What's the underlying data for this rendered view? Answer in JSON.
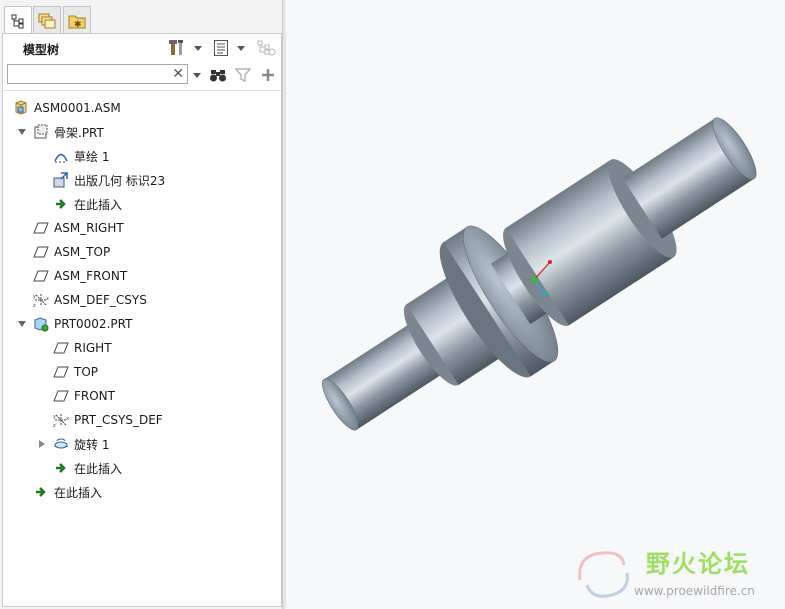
{
  "tabs": [
    {
      "name": "model-tree-tab",
      "icon": "model-tree-icon"
    },
    {
      "name": "layers-tab",
      "icon": "layers-icon"
    },
    {
      "name": "favorites-tab",
      "icon": "folder-star-icon"
    }
  ],
  "panel": {
    "title": "模型树",
    "toolbar": [
      "settings-icon",
      "tree-columns-icon",
      "show-filter-icon"
    ],
    "search": {
      "value": "",
      "placeholder": ""
    },
    "search_tools": [
      "binoculars-icon",
      "filter-icon",
      "add-icon"
    ]
  },
  "tree": [
    {
      "label": "ASM0001.ASM",
      "icon": "assembly-icon",
      "expander": ""
    },
    {
      "label": "骨架.PRT",
      "icon": "skeleton-part-icon",
      "expander": "expanded"
    },
    {
      "label": "草绘 1",
      "icon": "sketch-icon",
      "expander": ""
    },
    {
      "label": "出版几何 标识23",
      "icon": "publish-geometry-icon",
      "expander": ""
    },
    {
      "label": "在此插入",
      "icon": "insert-here-arrow-icon",
      "expander": ""
    },
    {
      "label": "ASM_RIGHT",
      "icon": "datum-plane-icon",
      "expander": ""
    },
    {
      "label": "ASM_TOP",
      "icon": "datum-plane-icon",
      "expander": ""
    },
    {
      "label": "ASM_FRONT",
      "icon": "datum-plane-icon",
      "expander": ""
    },
    {
      "label": "ASM_DEF_CSYS",
      "icon": "coordinate-system-icon",
      "expander": ""
    },
    {
      "label": "PRT0002.PRT",
      "icon": "part-icon",
      "expander": "expanded"
    },
    {
      "label": "RIGHT",
      "icon": "datum-plane-icon",
      "expander": ""
    },
    {
      "label": "TOP",
      "icon": "datum-plane-icon",
      "expander": ""
    },
    {
      "label": "FRONT",
      "icon": "datum-plane-icon",
      "expander": ""
    },
    {
      "label": "PRT_CSYS_DEF",
      "icon": "coordinate-system-icon",
      "expander": ""
    },
    {
      "label": "旋转 1",
      "icon": "revolve-icon",
      "expander": "collapsed"
    },
    {
      "label": "在此插入",
      "icon": "insert-here-arrow-icon",
      "expander": ""
    },
    {
      "label": "在此插入",
      "icon": "insert-here-arrow-icon",
      "expander": ""
    }
  ],
  "viewport": {
    "model": "stepped-shaft",
    "watermark": {
      "text": "野火论坛",
      "url": "www.proewildfire.cn"
    }
  },
  "colors": {
    "insert_arrow": "#1f7a1f",
    "shaft": "#8e9aa4",
    "watermark_green": "#7ed321"
  }
}
